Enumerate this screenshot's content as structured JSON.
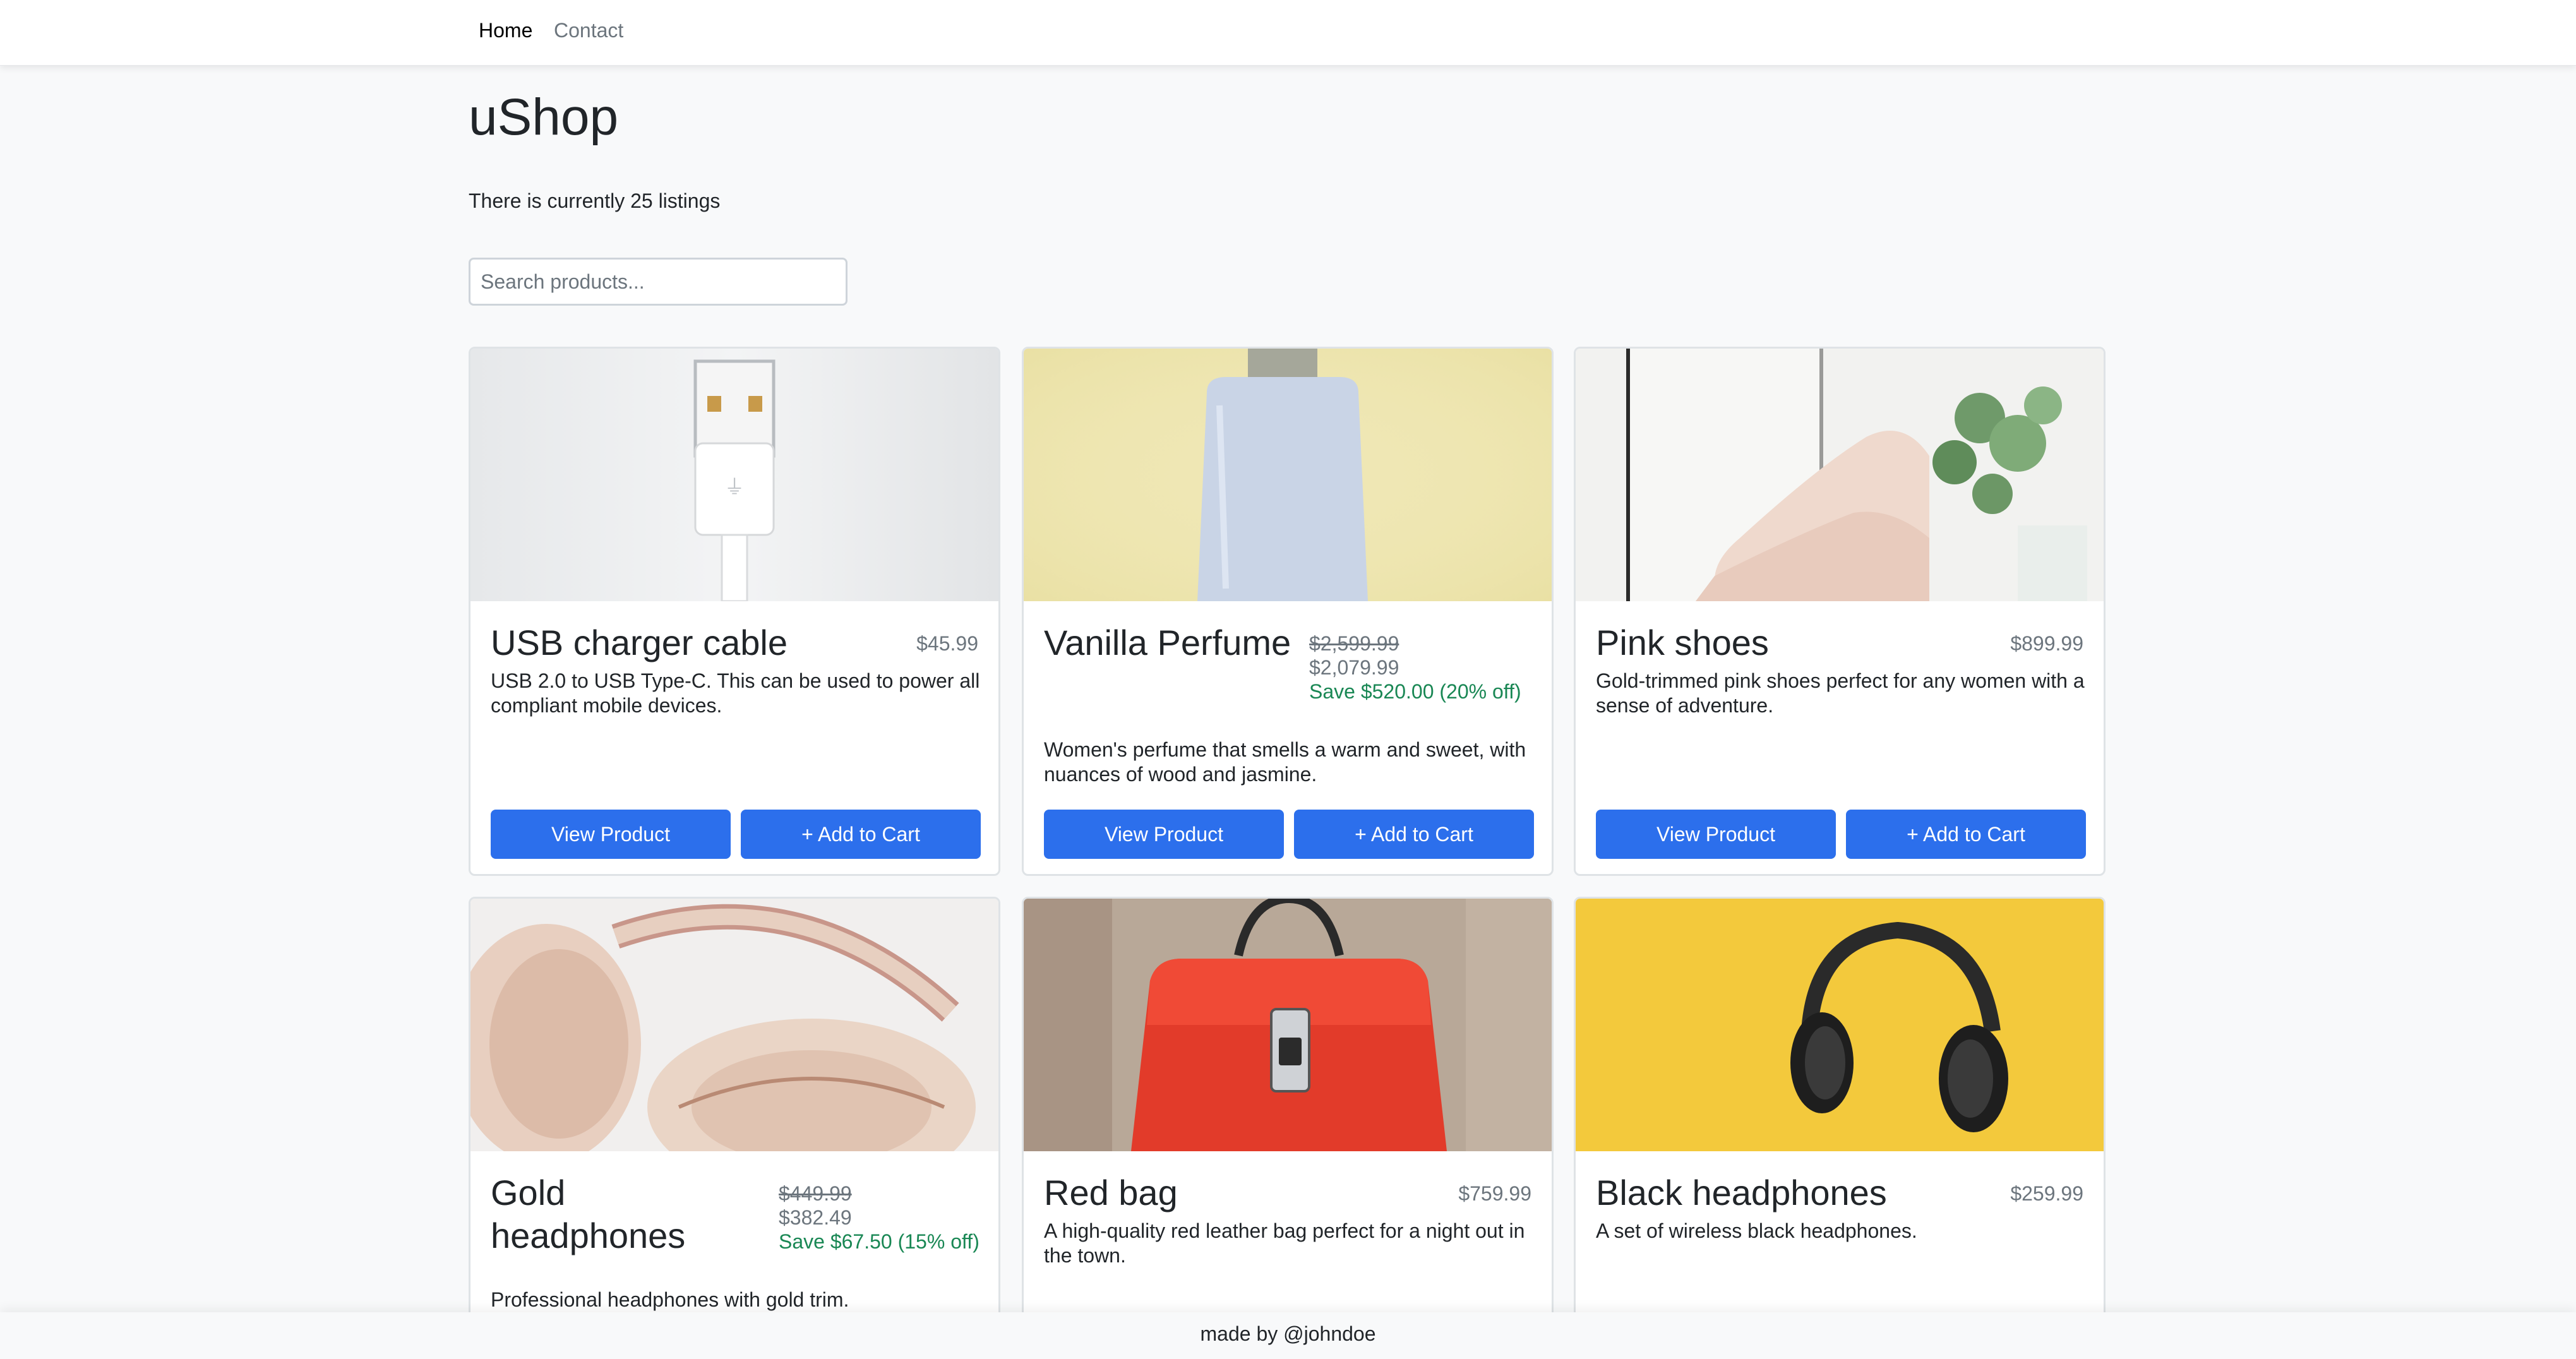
{
  "nav": {
    "home": "Home",
    "contact": "Contact"
  },
  "page": {
    "title": "uShop",
    "listings_text": "There is currently 25 listings",
    "search_placeholder": "Search products..."
  },
  "buttons": {
    "view": "View Product",
    "add": "+ Add to Cart"
  },
  "products": [
    {
      "name": "USB charger cable",
      "price": "$45.99",
      "description": "USB 2.0 to USB Type-C. This can be used to power all compliant mobile devices."
    },
    {
      "name": "Vanilla Perfume",
      "old_price": "$2,599.99",
      "price": "$2,079.99",
      "savings": "Save $520.00 (20% off)",
      "description": "Women's perfume that smells a warm and sweet, with nuances of wood and jasmine."
    },
    {
      "name": "Pink shoes",
      "price": "$899.99",
      "description": "Gold-trimmed pink shoes perfect for any women with a sense of adventure."
    },
    {
      "name": "Gold headphones",
      "old_price": "$449.99",
      "price": "$382.49",
      "savings": "Save $67.50 (15% off)",
      "description": "Professional headphones with gold trim."
    },
    {
      "name": "Red bag",
      "price": "$759.99",
      "description": "A high-quality red leather bag perfect for a night out in the town."
    },
    {
      "name": "Black headphones",
      "price": "$259.99",
      "description": "A set of wireless black headphones."
    }
  ],
  "footer": {
    "text": "made by @johndoe"
  },
  "colors": {
    "primary_button": "#2c6fec",
    "savings_text": "#198754",
    "page_background": "#f8f9fa"
  }
}
